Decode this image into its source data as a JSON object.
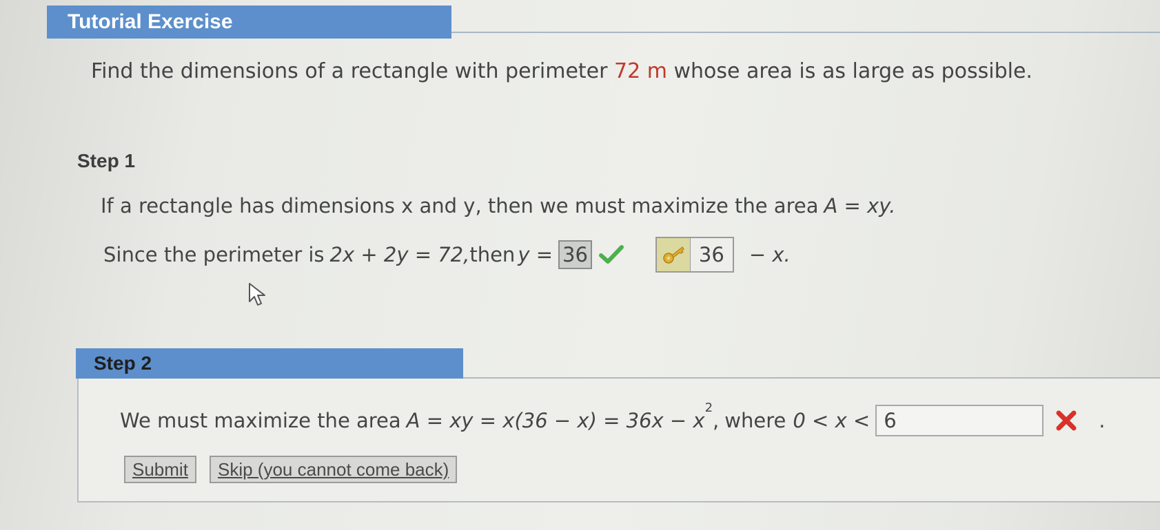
{
  "header": {
    "title": "Tutorial Exercise"
  },
  "question": {
    "prefix": "Find the dimensions of a rectangle with perimeter ",
    "perimeter_value": "72 m",
    "suffix": " whose area is as large as possible."
  },
  "step1": {
    "label": "Step 1",
    "line1": {
      "text": "If a rectangle has dimensions x and y, then we must maximize the area ",
      "formula": "A = xy."
    },
    "line2": {
      "prefix": "Since the perimeter is ",
      "equation": "2x + 2y = 72,",
      "then": " then ",
      "y_eq": "y =",
      "submitted_answer": "36",
      "correct_answer": "36",
      "tail": "− x."
    }
  },
  "step2": {
    "label": "Step 2",
    "line": {
      "prefix": "We must maximize the area ",
      "formula": "A = xy = x(36 − x) = 36x − x",
      "exponent": "2",
      "comma": ",",
      "where": " where ",
      "inequality": "0 < x <",
      "input_value": "6",
      "end": "."
    },
    "buttons": {
      "submit": "Submit",
      "skip": "Skip (you cannot come back)"
    }
  },
  "colors": {
    "header_blue": "#5d8fcc",
    "highlight_red": "#c0392b",
    "check_green": "#4caf50",
    "x_red": "#d9322b",
    "key_gold": "#e0b030"
  },
  "icons": {
    "check": "check-icon",
    "key": "key-icon",
    "wrong": "x-mark-icon",
    "cursor": "mouse-cursor-icon"
  }
}
